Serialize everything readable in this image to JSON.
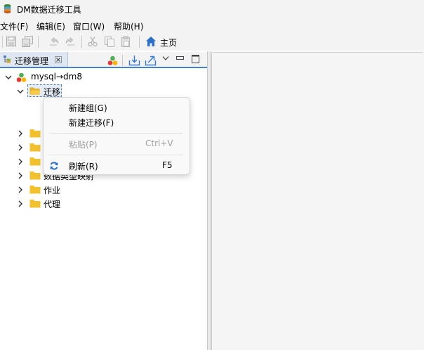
{
  "window": {
    "title": "DM数据迁移工具"
  },
  "menu": {
    "items": [
      "文件(F)",
      "编辑(E)",
      "窗口(W)",
      "帮助(H)"
    ]
  },
  "toolbar": {
    "home_label": "主页"
  },
  "view": {
    "tab_label": "迁移管理"
  },
  "tree": {
    "root": "mysql→dm8",
    "selected": "迁移",
    "hidden_item": "数据类型映射",
    "items": [
      "作业",
      "代理"
    ]
  },
  "context_menu": {
    "new_group": "新建组(G)",
    "new_migration": "新建迁移(F)",
    "paste": "粘贴(P)",
    "paste_shortcut": "Ctrl+V",
    "refresh": "刷新(R)",
    "refresh_shortcut": "F5"
  },
  "colors": {
    "accent": "#4a7fc1",
    "folder": "#f2c12e",
    "home_icon": "#2a6fc9",
    "refresh_icon": "#2a6fc9"
  }
}
